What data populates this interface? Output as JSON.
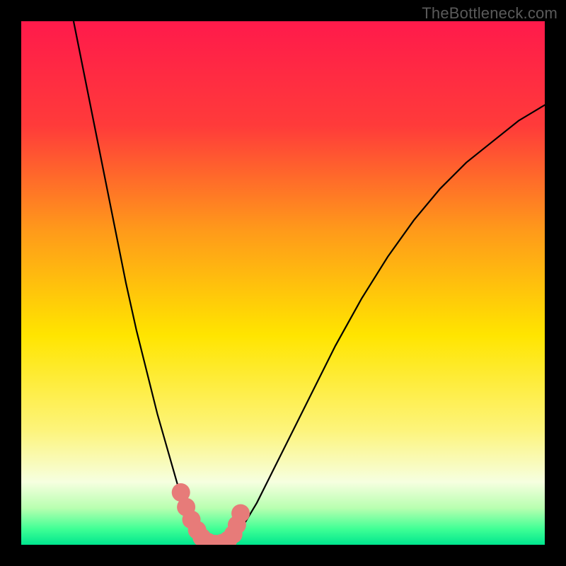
{
  "watermark": "TheBottleneck.com",
  "chart_data": {
    "type": "line",
    "title": "",
    "xlabel": "",
    "ylabel": "",
    "xlim": [
      0,
      100
    ],
    "ylim": [
      0,
      100
    ],
    "grid": false,
    "background_gradient": {
      "stops": [
        {
          "offset": 0.0,
          "color": "#ff1a4b"
        },
        {
          "offset": 0.2,
          "color": "#ff3b3a"
        },
        {
          "offset": 0.4,
          "color": "#ff9a1a"
        },
        {
          "offset": 0.6,
          "color": "#ffe500"
        },
        {
          "offset": 0.78,
          "color": "#fdf47a"
        },
        {
          "offset": 0.88,
          "color": "#f6ffe0"
        },
        {
          "offset": 0.93,
          "color": "#b8ffb0"
        },
        {
          "offset": 0.97,
          "color": "#3fff95"
        },
        {
          "offset": 1.0,
          "color": "#00e68e"
        }
      ]
    },
    "series": [
      {
        "name": "curve-left",
        "stroke": "#000000",
        "stroke_width": 2.2,
        "x": [
          10,
          12,
          14,
          16,
          18,
          20,
          22,
          24,
          26,
          28,
          30,
          31,
          32,
          33,
          34,
          35
        ],
        "y": [
          100,
          90,
          80,
          70,
          60,
          50,
          41,
          33,
          25,
          18,
          11,
          8,
          5.5,
          3.2,
          1.4,
          0.2
        ]
      },
      {
        "name": "curve-right",
        "stroke": "#000000",
        "stroke_width": 2.2,
        "x": [
          40,
          42,
          45,
          48,
          52,
          56,
          60,
          65,
          70,
          75,
          80,
          85,
          90,
          95,
          100
        ],
        "y": [
          0.2,
          3,
          8,
          14,
          22,
          30,
          38,
          47,
          55,
          62,
          68,
          73,
          77,
          81,
          84
        ]
      },
      {
        "name": "highlight-dots",
        "type": "scatter",
        "marker_color": "#e77b79",
        "marker_radius": 13,
        "x": [
          30.5,
          31.5,
          32.5,
          33.6,
          34.5,
          35.7,
          37.0,
          38.3,
          39.5,
          40.5,
          41.2,
          41.9
        ],
        "y": [
          10.0,
          7.2,
          4.8,
          2.8,
          1.4,
          0.5,
          0.15,
          0.3,
          0.9,
          2.0,
          3.8,
          6.0
        ]
      }
    ]
  }
}
